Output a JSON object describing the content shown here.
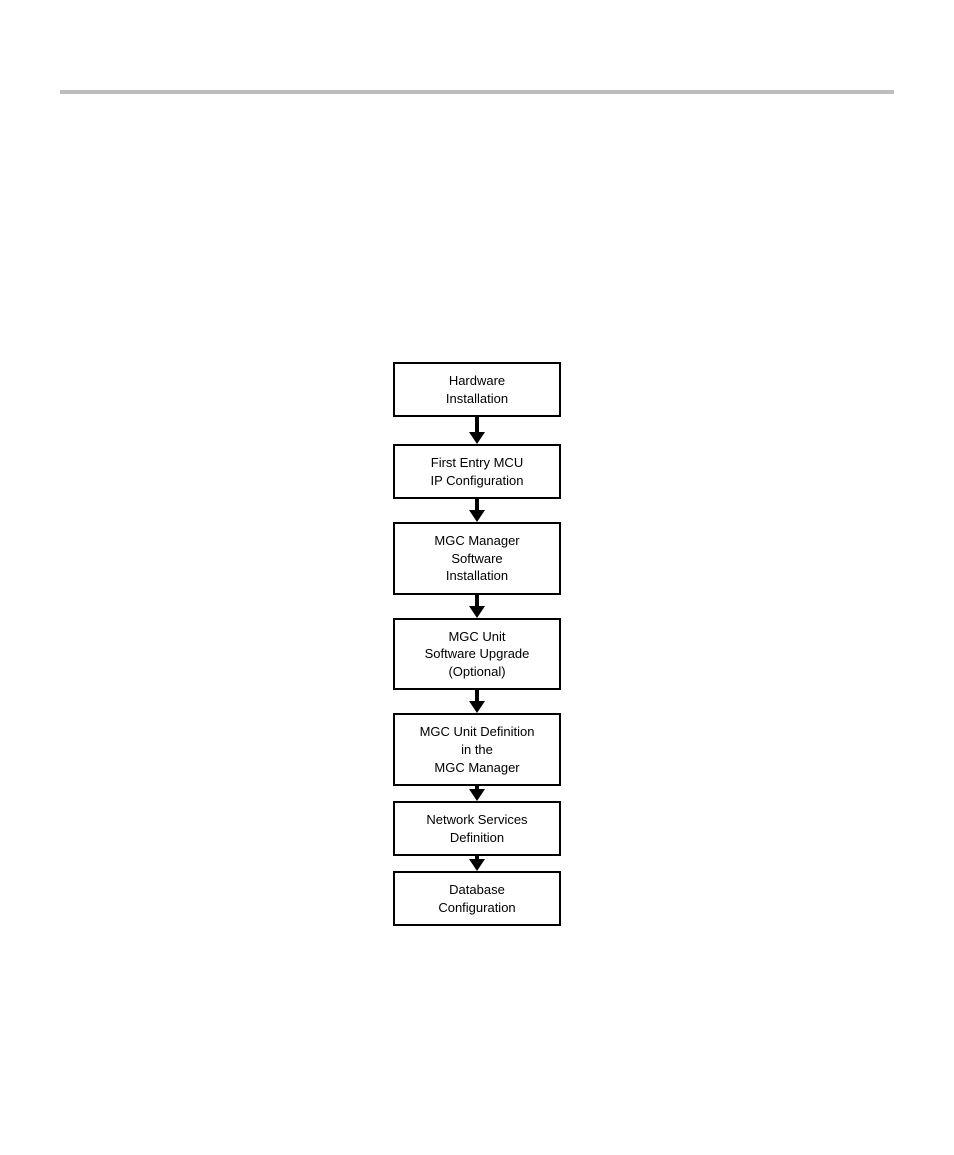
{
  "flow": {
    "boxes": [
      {
        "lines": [
          "Hardware",
          "Installation"
        ]
      },
      {
        "lines": [
          "First Entry MCU",
          "IP Configuration"
        ]
      },
      {
        "lines": [
          "MGC Manager",
          "Software",
          "Installation"
        ]
      },
      {
        "lines": [
          "MGC Unit",
          "Software Upgrade",
          "(Optional)"
        ]
      },
      {
        "lines": [
          "MGC Unit Definition",
          "in the",
          "MGC Manager"
        ]
      },
      {
        "lines": [
          "Network Services",
          "Definition"
        ]
      },
      {
        "lines": [
          "Database",
          "Configuration"
        ]
      }
    ],
    "arrow_shaft_heights": [
      16,
      12,
      12,
      12,
      4,
      4
    ]
  }
}
